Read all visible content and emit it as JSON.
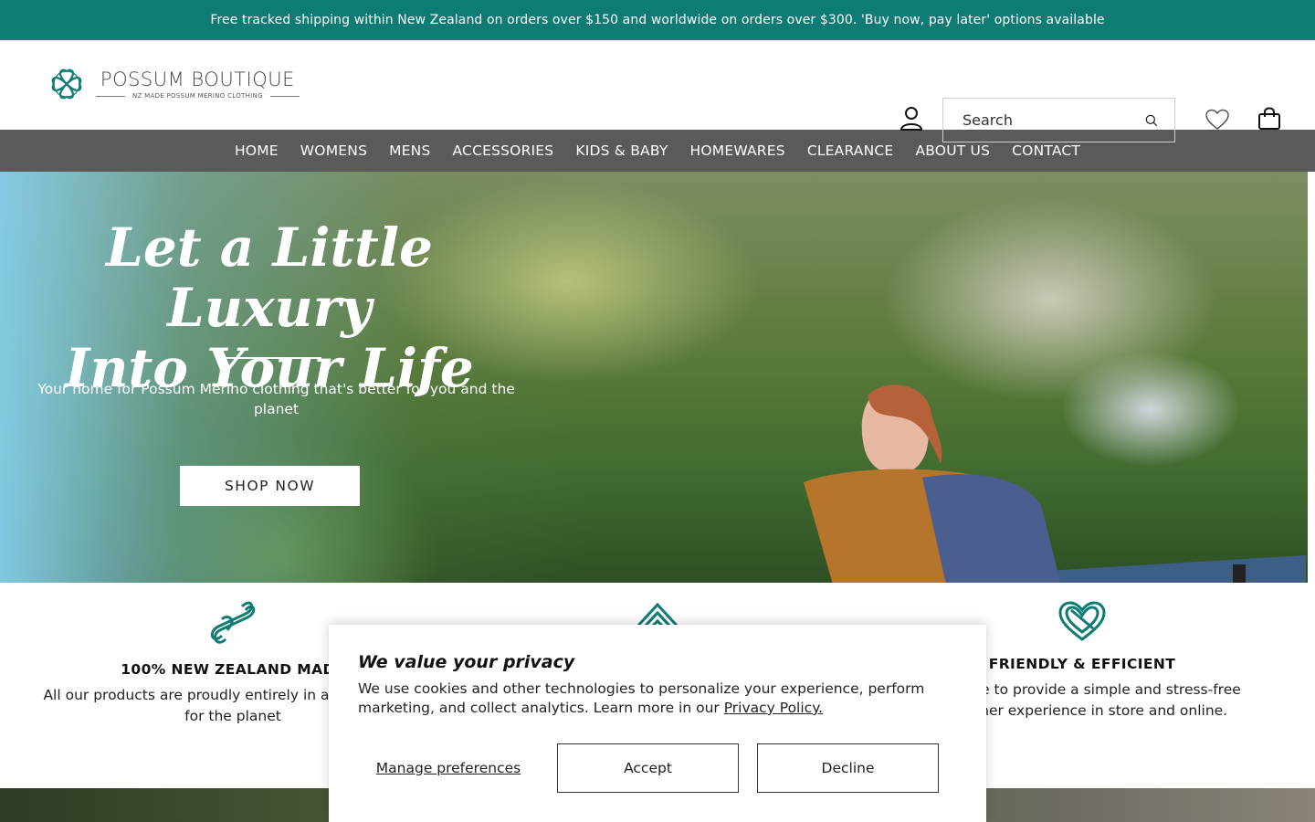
{
  "announcement": "Free tracked shipping within New Zealand on orders over $150 and worldwide on orders over $300. 'Buy now, pay later' options available",
  "brand": {
    "name": "POSSUM BOUTIQUE",
    "tagline": "NZ MADE POSSUM MERINO CLOTHING",
    "color": "#0e7c75"
  },
  "header": {
    "search_placeholder": "Search",
    "icons": [
      "account-icon",
      "search-icon",
      "heart-icon",
      "bag-icon"
    ]
  },
  "nav": {
    "items": [
      "HOME",
      "WOMENS",
      "MENS",
      "ACCESSORIES",
      "KIDS & BABY",
      "HOMEWARES",
      "CLEARANCE",
      "ABOUT US",
      "CONTACT"
    ]
  },
  "hero": {
    "title_line1": "Let a Little Luxury",
    "title_line2": "Into Your Life",
    "subtitle": "Your home for Possum Merino clothing that's better for you and the planet",
    "cta": "SHOP NOW"
  },
  "features": [
    {
      "title": "100% NEW ZEALAND MADE",
      "text": "All our products are proudly entirely in and are better for the planet"
    },
    {
      "title": "",
      "text": ""
    },
    {
      "title": "FRIENDLY & EFFICIENT",
      "text": "We strive to provide a simple and stress-free customer experience in store and online."
    }
  ],
  "cookie": {
    "title": "We value your privacy",
    "body": "We use cookies and other technologies to personalize your experience, perform marketing, and collect analytics. Learn more in our",
    "policy_link": "Privacy Policy.",
    "manage": "Manage preferences",
    "accept": "Accept",
    "decline": "Decline"
  }
}
